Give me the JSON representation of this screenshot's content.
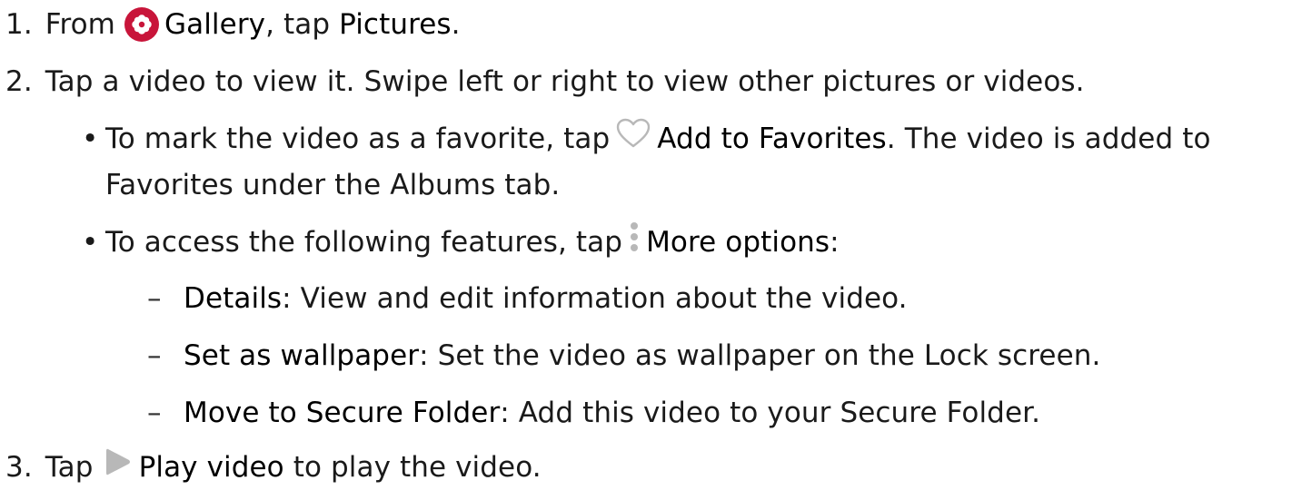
{
  "steps": [
    {
      "num": "1.",
      "t1": "From",
      "icon": "gallery-icon",
      "b1": "Gallery",
      "t2": ", tap ",
      "b2": "Pictures",
      "t3": "."
    },
    {
      "num": "2.",
      "text": "Tap a video to view it. Swipe left or right to view other pictures or videos."
    },
    {
      "num": "3.",
      "t1": "Tap",
      "icon": "play-icon",
      "b1": "Play video",
      "t2": " to play the video."
    }
  ],
  "bullets": [
    {
      "t1": "To mark the video as a favorite, tap",
      "icon": "heart-icon",
      "b1": "Add to Favorites",
      "t2": ". The video is added to",
      "line2": "Favorites under the Albums tab."
    },
    {
      "t1": "To access the following features, tap",
      "icon": "more-options-icon",
      "b1": "More options",
      "t2": ":"
    }
  ],
  "subitems": [
    {
      "b": "Details",
      "t": ": View and edit information about the video."
    },
    {
      "b": "Set as wallpaper",
      "t": ": Set the video as wallpaper on the Lock screen."
    },
    {
      "b": "Move to Secure Folder",
      "t": ": Add this video to your Secure Folder."
    }
  ],
  "colors": {
    "gallery_icon": "#c8153a",
    "icon_gray": "#b8b8b8",
    "text": "#1a1a1a"
  }
}
